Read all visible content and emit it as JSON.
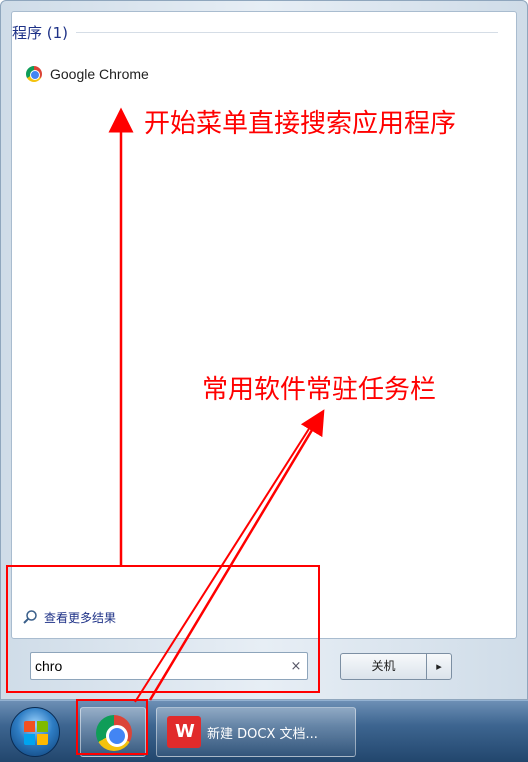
{
  "start_menu": {
    "section_title": "程序 (1)",
    "results": [
      {
        "label": "Google Chrome",
        "icon": "chrome-icon"
      }
    ],
    "see_more_label": "查看更多结果",
    "search": {
      "value": "chro",
      "clear_glyph": "×"
    },
    "shutdown": {
      "label": "关机",
      "arrow": "▸"
    }
  },
  "taskbar": {
    "pinned": [
      {
        "name": "chrome",
        "icon": "chrome-icon"
      }
    ],
    "windows": [
      {
        "label": "新建 DOCX 文档...",
        "icon": "wps-writer-icon"
      }
    ]
  },
  "annotations": {
    "search_note": "开始菜单直接搜索应用程序",
    "taskbar_note": "常用软件常驻任务栏",
    "color": "#ff0000"
  }
}
